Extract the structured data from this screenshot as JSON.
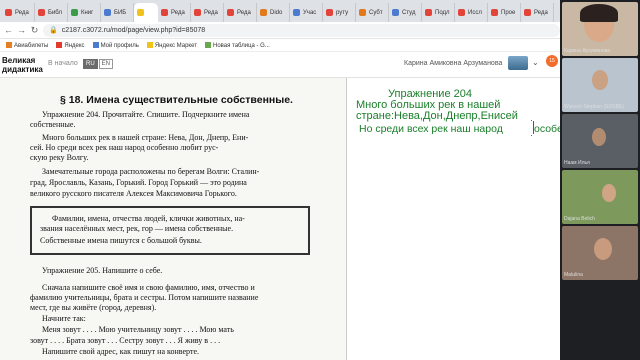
{
  "browser": {
    "tabs": [
      "Реда",
      "Библ",
      "Книг",
      "БИБ",
      "",
      "Реда",
      "Реда",
      "Реда",
      "Dido",
      "Учас",
      "руту",
      "Субт",
      "Студ",
      "Подл",
      "Иссл",
      "Прое",
      "Реда"
    ],
    "url": "c2187.c3072.ru/mod/page/view.php?id=85078",
    "bookmarks": [
      "Авиабилеты",
      "Яндекс",
      "Мой профиль",
      "Яндекс Маркет",
      "Новая таблица - G..."
    ]
  },
  "site": {
    "logo_line1": "Великая",
    "logo_line2": "дидактика",
    "home": "В начало",
    "lang_ru": "RU",
    "lang_en": "EN",
    "user_name": "Карина Амиковна Арзуманова",
    "notif_count": "15"
  },
  "textbook": {
    "heading": "§ 18. Имена существительные собственные.",
    "lines": [
      "Упражнение 204. Прочитайте. Спишите. Подчеркните имена",
      "собственные.",
      "Много больших рек в нашей стране: Нева, Дон, Днепр, Ени-",
      "сей. Но среди всех рек наш народ особенно любит рус-",
      "скую реку Волгу.",
      "Замечательные города расположены по берегам Волги: Сталин-",
      "град, Ярославль, Казань, Горький. Город Горький — это родина",
      "великого русского писателя Алексея Максимовича Горького.",
      "Фамилии, имена, отчества людей, клички животных, на-",
      "звания населённых мест, рек, гор — имена собственные.",
      "Собственные имена пишутся с большой буквы.",
      "Упражнение 205. Напишите о себе.",
      "Сначала напишите своё имя и свою фамилию, имя, отчество и",
      "фамилию учительницы, брата и сестры. Потом напишите название",
      "мест, где вы живёте (город, деревня).",
      "Начните так:",
      "Меня зовут . . . . Мою учительницу зовут . . . . Мою мать",
      "зовут . . . . Брата зовут . . . Сестру зовут . . . Я живу в . . .",
      "Напишите свой адрес, как пишут на конверте."
    ]
  },
  "whiteboard": {
    "line1": "Упражнение 204",
    "line2": "Много больших рек в нашей",
    "line3": "стране:Нева,Дон,Днепр,Енисей",
    "line4": "Но среди всех рек наш народ",
    "line4_tail": "особе"
  },
  "participants": [
    "Карина Арзуманова",
    "Wunsch Stephan (SOSBE)",
    "Наам Илья",
    "Dajana Belich",
    "Matulina"
  ],
  "help_glyph": "?"
}
